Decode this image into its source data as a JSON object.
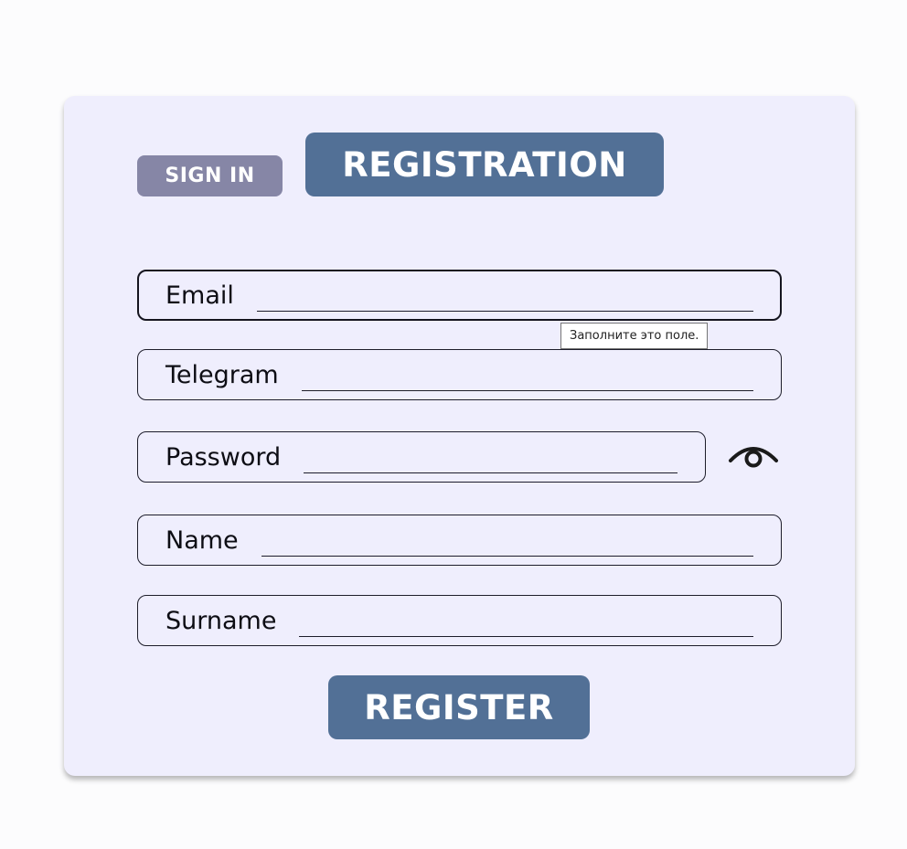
{
  "tabs": {
    "sign_in": "SIGN IN",
    "registration": "REGISTRATION"
  },
  "fields": {
    "email": {
      "label": "Email",
      "value": ""
    },
    "telegram": {
      "label": "Telegram",
      "value": ""
    },
    "password": {
      "label": "Password",
      "value": ""
    },
    "name": {
      "label": "Name",
      "value": ""
    },
    "surname": {
      "label": "Surname",
      "value": ""
    }
  },
  "validation_tooltip": "Заполните это поле.",
  "password_toggle_icon": "eye-icon",
  "register_button": "REGISTER",
  "colors": {
    "accent": "#527096",
    "inactive_tab": "#8686a6",
    "card_background": "#efeefd",
    "page_background": "#fcfcfd"
  }
}
